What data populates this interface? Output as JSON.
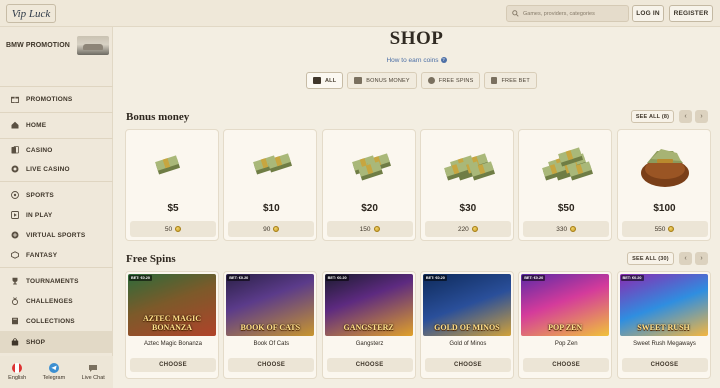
{
  "header": {
    "logo_text": "Vip Luck",
    "search_placeholder": "Games, providers, categories",
    "login_label": "LOG IN",
    "register_label": "REGISTER"
  },
  "sidebar": {
    "promo_label": "BMW PROMOTION",
    "items": [
      {
        "label": "PROMOTIONS",
        "icon": "gift-icon"
      },
      {
        "label": "HOME",
        "icon": "home-icon"
      },
      {
        "label": "CASINO",
        "icon": "cards-icon"
      },
      {
        "label": "LIVE CASINO",
        "icon": "chip-icon"
      },
      {
        "label": "SPORTS",
        "icon": "ball-icon"
      },
      {
        "label": "IN PLAY",
        "icon": "play-icon"
      },
      {
        "label": "VIRTUAL SPORTS",
        "icon": "virtual-icon"
      },
      {
        "label": "FANTASY",
        "icon": "fantasy-icon"
      },
      {
        "label": "TOURNAMENTS",
        "icon": "trophy-icon"
      },
      {
        "label": "CHALLENGES",
        "icon": "medal-icon"
      },
      {
        "label": "COLLECTIONS",
        "icon": "book-icon"
      },
      {
        "label": "SHOP",
        "icon": "bag-icon"
      }
    ],
    "bottom": [
      {
        "label": "English",
        "icon": "flag-icon"
      },
      {
        "label": "Telegram",
        "icon": "telegram-icon"
      },
      {
        "label": "Live Chat",
        "icon": "chat-icon"
      }
    ]
  },
  "main": {
    "title": "SHOP",
    "earn_link": "How to earn coins",
    "tabs": [
      {
        "label": "ALL",
        "active": true
      },
      {
        "label": "BONUS MONEY",
        "active": false
      },
      {
        "label": "FREE SPINS",
        "active": false
      },
      {
        "label": "FREE BET",
        "active": false
      }
    ],
    "bonus_section": {
      "title": "Bonus money",
      "see_all": "SEE ALL (8)",
      "cards": [
        {
          "price": "$5",
          "coins": "50"
        },
        {
          "price": "$10",
          "coins": "90"
        },
        {
          "price": "$20",
          "coins": "150"
        },
        {
          "price": "$30",
          "coins": "220"
        },
        {
          "price": "$50",
          "coins": "330"
        },
        {
          "price": "$100",
          "coins": "550"
        }
      ]
    },
    "spins_section": {
      "title": "Free Spins",
      "see_all": "SEE ALL (30)",
      "choose_label": "CHOOSE",
      "games": [
        {
          "name": "Aztec Magic Bonanza",
          "bet": "BET: €0.20",
          "art_text": "AZTEC MAGIC BONANZA"
        },
        {
          "name": "Book Of Cats",
          "bet": "BET: €0.20",
          "art_text": "BOOK OF CATS"
        },
        {
          "name": "Gangsterz",
          "bet": "BET: €0.20",
          "art_text": "GANGSTERZ"
        },
        {
          "name": "Gold of Minos",
          "bet": "BET: €0.20",
          "art_text": "GOLD OF MINOS"
        },
        {
          "name": "Pop Zen",
          "bet": "BET: €0.20",
          "art_text": "POP ZEN"
        },
        {
          "name": "Sweet Rush Megaways",
          "bet": "BET: €0.20",
          "art_text": "SWEET RUSH"
        }
      ]
    }
  },
  "colors": {
    "background": "#f3eee2",
    "sidebar": "#efe8da",
    "link": "#4c6fa6",
    "coin": "#d9b23f",
    "money": "#8a9a5b"
  }
}
